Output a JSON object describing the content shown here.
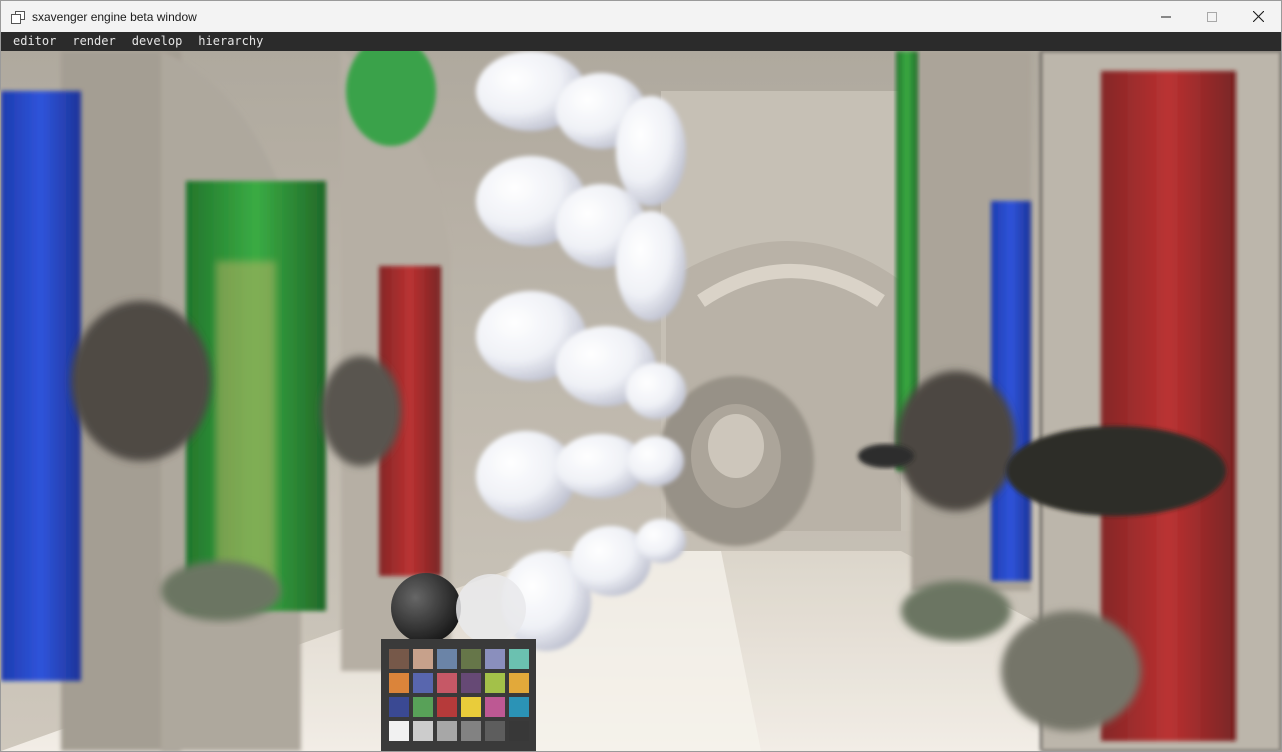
{
  "window": {
    "title": "sxavenger engine beta window",
    "icon": "app-window-icon",
    "controls": [
      "minimize-icon",
      "maximize-icon",
      "close-icon"
    ]
  },
  "menubar": {
    "items": [
      {
        "label": "editor"
      },
      {
        "label": "render"
      },
      {
        "label": "develop"
      },
      {
        "label": "hierarchy"
      }
    ]
  },
  "viewport": {
    "scene": "3D rendered courtyard with colored curtains, lion-head relief, rows of white spheres and a color-checker cube"
  },
  "colors": {
    "titlebar_bg": "#f3f3f3",
    "menubar_bg": "#2b2b2b",
    "menu_text": "#e6e6e6"
  }
}
